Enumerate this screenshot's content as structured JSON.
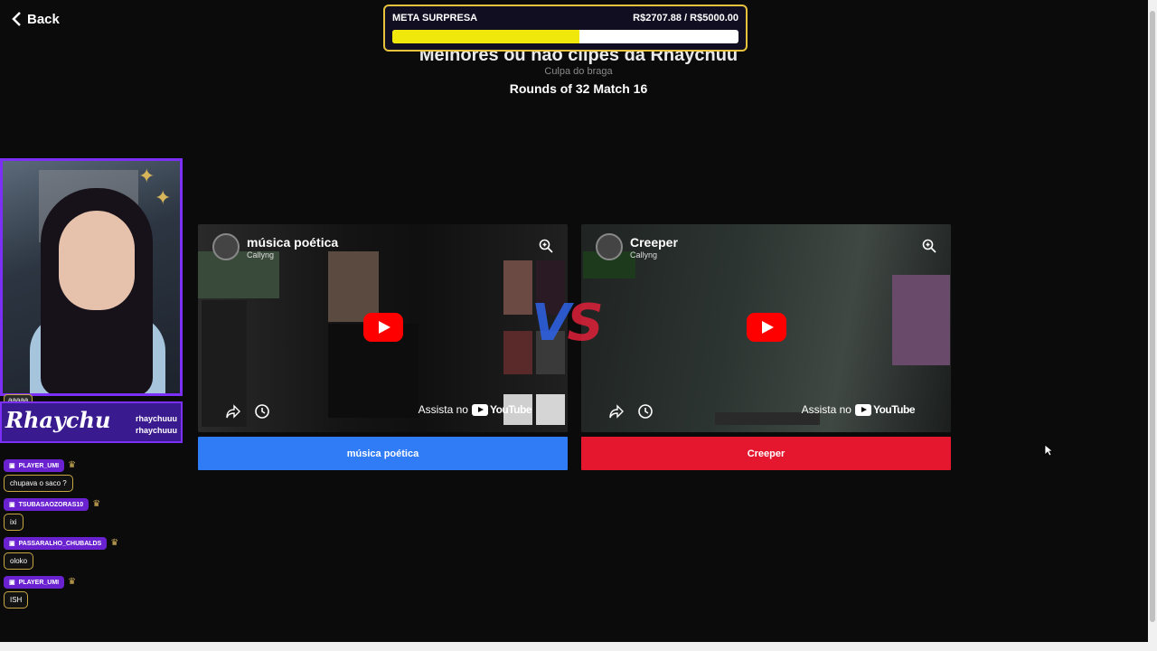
{
  "nav": {
    "back_label": "Back"
  },
  "header": {
    "title": "Melhores ou não clipes da Rhaychuu",
    "subtitle": "Culpa do braga",
    "rounds": "Rounds of 32 Match 16"
  },
  "meta": {
    "label": "META SURPRESA",
    "amount": "R$2707.88 / R$5000.00",
    "progress": 0.5416,
    "fill_color": "#f1e80b"
  },
  "stream": {
    "brand": "Rhaychu",
    "handles": [
      "rhaychuuu",
      "rhaychuuu"
    ]
  },
  "chat": {
    "first_fragment": "aaaaa",
    "messages": [
      {
        "user": "PLAYER_UMI",
        "text": "chupava o saco ?"
      },
      {
        "user": "TSUBASAOZORAS10",
        "text": "ixi"
      },
      {
        "user": "PASSARALHO_CHUBALDS",
        "text": "oloko"
      },
      {
        "user": "PLAYER_UMI",
        "text": "ISH"
      }
    ]
  },
  "matchup": {
    "vs": [
      "V",
      "S"
    ],
    "left": {
      "title": "música poética",
      "channel": "Callyng",
      "watch_label": "Assista no",
      "yt_label": "YouTube",
      "button_label": "música poética",
      "color": "#2f7cf6"
    },
    "right": {
      "title": "Creeper",
      "channel": "Callyng",
      "watch_label": "Assista no",
      "yt_label": "YouTube",
      "button_label": "Creeper",
      "color": "#e5172f"
    }
  }
}
